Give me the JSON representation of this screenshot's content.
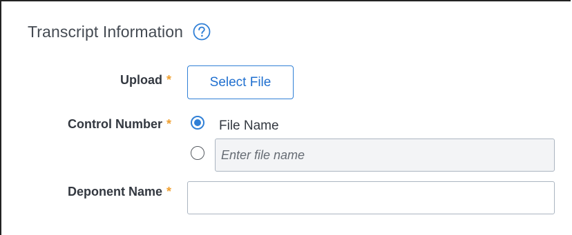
{
  "section": {
    "title": "Transcript Information",
    "help_icon": "question-circle-icon"
  },
  "form": {
    "required_marker": "*",
    "accent_color": "#2f7fd6",
    "required_color": "#f0a030",
    "upload": {
      "label": "Upload",
      "button_label": "Select File"
    },
    "control_number": {
      "label": "Control Number",
      "selected_option": "File Name",
      "options": [
        {
          "label": "File Name",
          "checked": true
        },
        {
          "label": "",
          "checked": false
        }
      ],
      "custom_input": {
        "value": "",
        "placeholder": "Enter file name"
      }
    },
    "deponent_name": {
      "label": "Deponent Name",
      "value": "",
      "placeholder": ""
    }
  }
}
